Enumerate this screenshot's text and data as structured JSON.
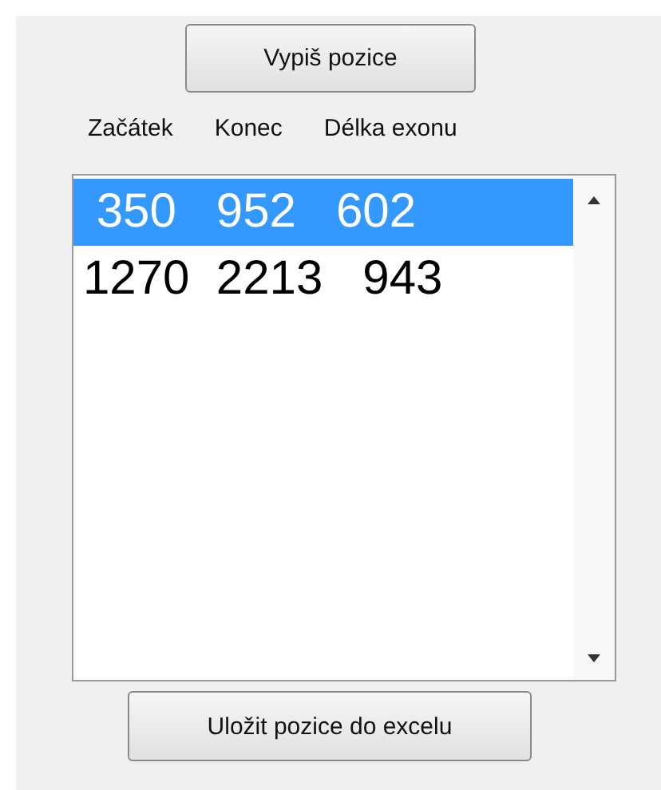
{
  "top_button": {
    "label": "Vypiš pozice"
  },
  "headers": [
    "Začátek",
    "Konec",
    "Délka exonu"
  ],
  "list": {
    "items": [
      {
        "text": " 350   952   602",
        "selected": true
      },
      {
        "text": "1270  2213   943",
        "selected": false
      }
    ]
  },
  "bottom_button": {
    "label": "Uložit pozice do excelu"
  }
}
